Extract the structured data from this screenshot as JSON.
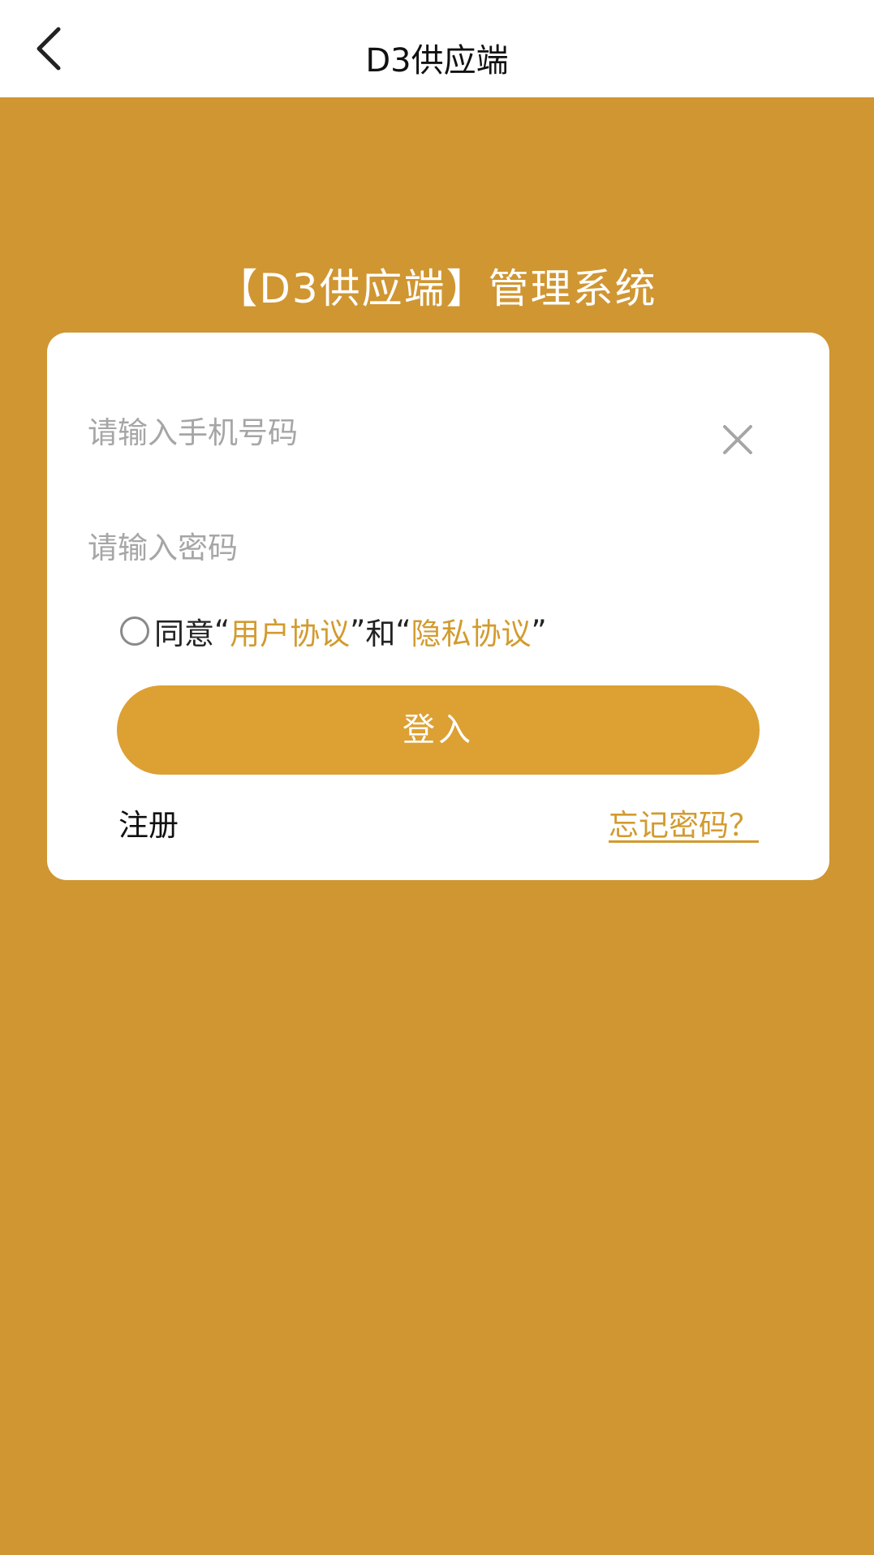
{
  "header": {
    "title": "D3供应端"
  },
  "page": {
    "heading": "【D3供应端】管理系统"
  },
  "form": {
    "phone_placeholder": "请输入手机号码",
    "phone_value": "",
    "password_placeholder": "请输入密码",
    "password_value": "",
    "agree_prefix": "同意",
    "quote_open_1": "“",
    "user_agreement": "用户协议",
    "quote_close_1": "”",
    "and_text": "和",
    "quote_open_2": "“",
    "privacy_agreement": "隐私协议",
    "quote_close_2": "”",
    "agreed": false,
    "login_label": "登入",
    "register_label": "注册",
    "forgot_label": "忘记密码？"
  },
  "icons": {
    "back": "chevron-left-icon",
    "clear": "close-icon",
    "agree": "radio-unchecked-icon"
  },
  "colors": {
    "background": "#D09632",
    "accent": "#DDA033",
    "link": "#D29B2F",
    "card": "#FFFFFF"
  }
}
